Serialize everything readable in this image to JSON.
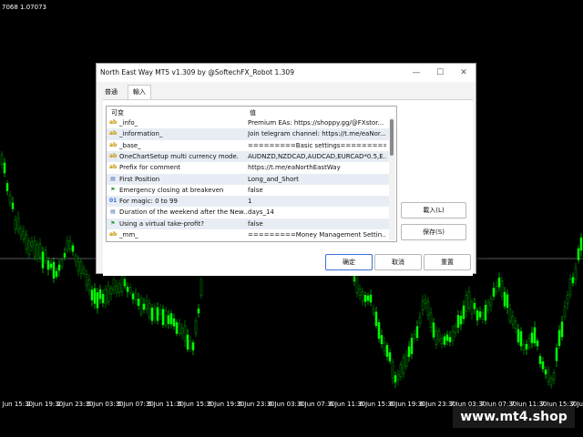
{
  "chart": {
    "price_label": "7068 1.07073",
    "x_labels": [
      "5 Jun 15:30",
      "2 Jun 19:30",
      "2 Jun 23:30",
      "5 Jun 03:30",
      "5 Jun 07:30",
      "5 Jun 11:30",
      "5 Jun 15:30",
      "5 Jun 19:30",
      "5 Jun 23:30",
      "6 Jun 03:30",
      "6 Jun 07:30",
      "6 Jun 11:30",
      "6 Jun 15:30",
      "6 Jun 19:30",
      "6 Jun 23:30",
      "7 Jun 03:30",
      "7 Jun 07:30",
      "7 Jun 11:30",
      "7 Jun 15:30",
      "7 Jun 19:30"
    ],
    "watermark": "www.mt4.shop",
    "bull_color": "#00ff00",
    "bear_color": "#00a000"
  },
  "dialog": {
    "title": "North East Way MT5 v1.309 by @SoftechFX_Robot 1.309",
    "minimize": "—",
    "maximize": "☐",
    "close": "✕",
    "tabs": [
      {
        "label": "普通",
        "active": false
      },
      {
        "label": "輸入",
        "active": true
      }
    ],
    "columns": {
      "variable": "可变",
      "value": "值"
    },
    "rows": [
      {
        "icon": "ab",
        "name": "_info_",
        "value": "Premium EAs: https://shoppy.gg/@FXstor..."
      },
      {
        "icon": "ab",
        "name": "_information_",
        "value": "Join telegram channel: https://t.me/eaNor..."
      },
      {
        "icon": "ab",
        "name": "_base_",
        "value": "=========Basic settings========="
      },
      {
        "icon": "ab",
        "name": "OneChartSetup multi currency mode.",
        "value": "AUDNZD,NZDCAD,AUDCAD,EURCAD*0.5,E..."
      },
      {
        "icon": "ab",
        "name": "Prefix for comment",
        "value": "https://t.me/eaNorthEastWay"
      },
      {
        "icon": "enum",
        "name": "First Position",
        "value": "Long_and_Short"
      },
      {
        "icon": "bool",
        "name": "Emergency closing at breakeven",
        "value": "false"
      },
      {
        "icon": "01",
        "name": "For magic: 0 to 99",
        "value": "1"
      },
      {
        "icon": "enum",
        "name": "Duration of the weekend after the New...",
        "value": "days_14"
      },
      {
        "icon": "bool",
        "name": "Using a virtual take-profit?",
        "value": "false"
      },
      {
        "icon": "ab",
        "name": "_mm_",
        "value": "=========Money Management Settin..."
      }
    ],
    "load_button": "載入(L)",
    "save_button": "保存(S)",
    "ok_button": "确定",
    "cancel_button": "取消",
    "reset_button": "重置"
  }
}
